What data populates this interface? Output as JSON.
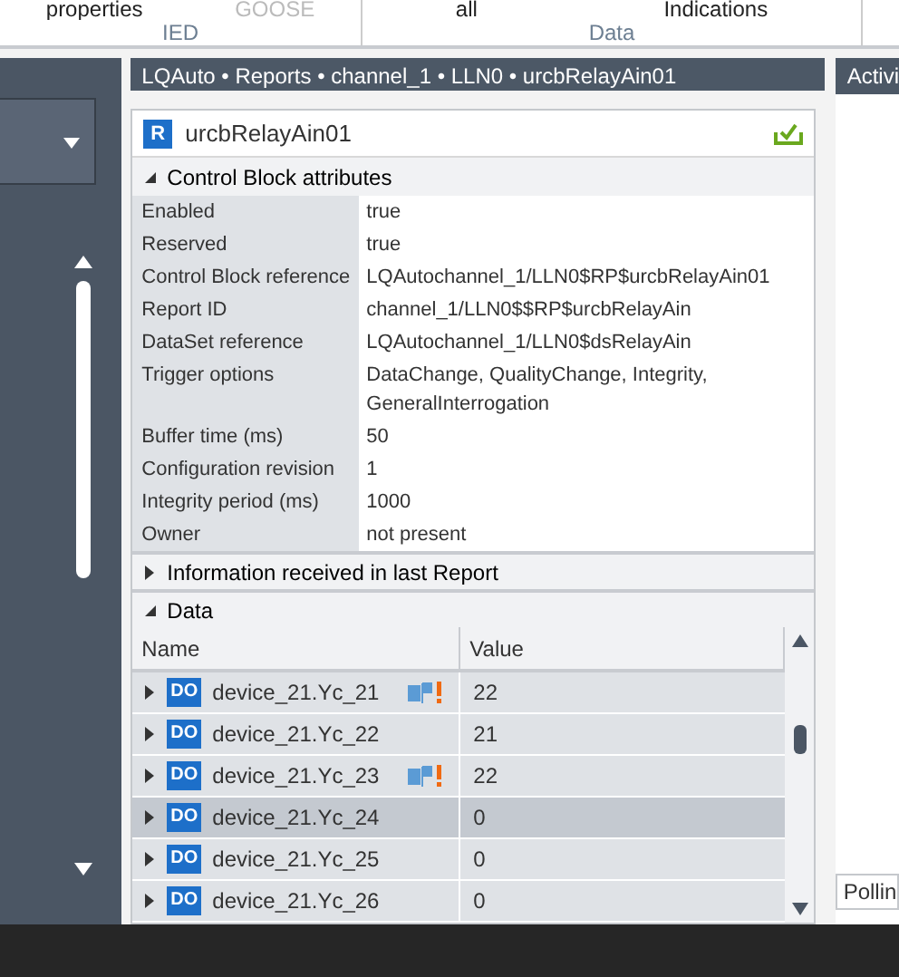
{
  "ribbon": {
    "groups": [
      {
        "label": "IED",
        "buttons": [
          {
            "label": "properties",
            "disabled": false
          },
          {
            "label": "GOOSE",
            "disabled": true
          }
        ]
      },
      {
        "label": "Data",
        "buttons": [
          {
            "label": "all",
            "disabled": false
          },
          {
            "label": "Indications",
            "disabled": false
          }
        ]
      }
    ]
  },
  "breadcrumb": "LQAuto • Reports • channel_1 • LLN0 • urcbRelayAin01",
  "card": {
    "badge": "R",
    "title": "urcbRelayAin01",
    "sections": [
      {
        "kind": "attributes",
        "title": "Control Block attributes",
        "expanded": true,
        "rows": [
          {
            "label": "Enabled",
            "value": "true"
          },
          {
            "label": "Reserved",
            "value": "true"
          },
          {
            "label": "Control Block reference",
            "value": "LQAutochannel_1/LLN0$RP$urcbRelayAin01"
          },
          {
            "label": "Report ID",
            "value": "channel_1/LLN0$$RP$urcbRelayAin"
          },
          {
            "label": "DataSet reference",
            "value": "LQAutochannel_1/LLN0$dsRelayAin"
          },
          {
            "label": "Trigger options",
            "value": "DataChange, QualityChange, Integrity, GeneralInterrogation"
          },
          {
            "label": "Buffer time (ms)",
            "value": "50"
          },
          {
            "label": "Configuration revision",
            "value": "1"
          },
          {
            "label": "Integrity period (ms)",
            "value": "1000"
          },
          {
            "label": "Owner",
            "value": "not present"
          }
        ]
      },
      {
        "kind": "info",
        "title": "Information received in last Report",
        "expanded": false
      },
      {
        "kind": "data",
        "title": "Data",
        "expanded": true,
        "table": {
          "columns": [
            "Name",
            "Value"
          ],
          "rows": [
            {
              "badge": "DO",
              "name": "device_21.Yc_21",
              "flagged": true,
              "value": "22",
              "selected": false
            },
            {
              "badge": "DO",
              "name": "device_21.Yc_22",
              "flagged": false,
              "value": "21",
              "selected": false
            },
            {
              "badge": "DO",
              "name": "device_21.Yc_23",
              "flagged": true,
              "value": "22",
              "selected": false
            },
            {
              "badge": "DO",
              "name": "device_21.Yc_24",
              "flagged": false,
              "value": "0",
              "selected": true
            },
            {
              "badge": "DO",
              "name": "device_21.Yc_25",
              "flagged": false,
              "value": "0",
              "selected": false
            },
            {
              "badge": "DO",
              "name": "device_21.Yc_26",
              "flagged": false,
              "value": "0",
              "selected": false
            }
          ]
        }
      }
    ]
  },
  "right_panel": {
    "title": "Activi",
    "footer": "Pollin"
  }
}
